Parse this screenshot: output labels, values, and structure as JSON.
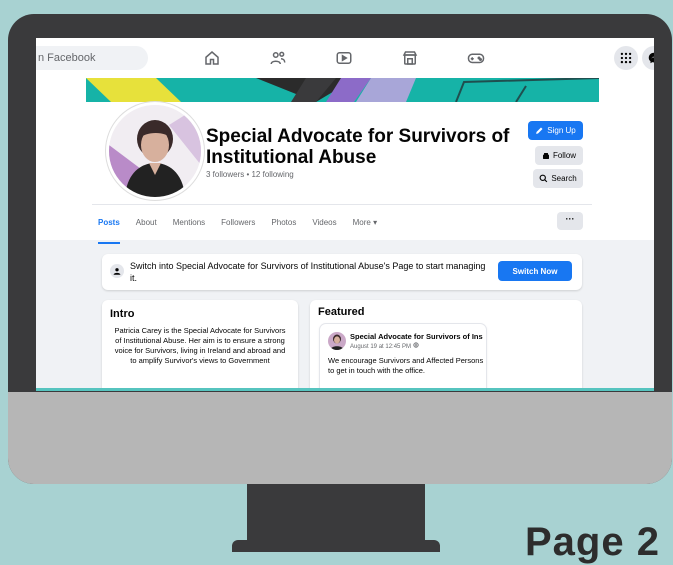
{
  "topbar": {
    "search_placeholder": "n Facebook",
    "nav_icons": [
      "home-icon",
      "friends-icon",
      "watch-icon",
      "marketplace-icon",
      "gaming-icon"
    ],
    "right_icons": [
      "menu-grid-icon",
      "messenger-icon"
    ]
  },
  "profile": {
    "name": "Special Advocate for Survivors of Institutional Abuse",
    "follows": "3 followers • 12 following",
    "buttons": {
      "signup": "Sign Up",
      "follow": "Follow",
      "search": "Search"
    }
  },
  "tabs": [
    "Posts",
    "About",
    "Mentions",
    "Followers",
    "Photos",
    "Videos",
    "More ▾"
  ],
  "more_button": "···",
  "switch_banner": {
    "text": "Switch into Special Advocate for Survivors of Institutional Abuse's Page to start managing it.",
    "button": "Switch Now"
  },
  "intro": {
    "title": "Intro",
    "text": "Patricia Carey is the Special Advocate for Survivors of Institutional Abuse. Her aim is to ensure a strong voice for Survivors, living in Ireland and abroad and to amplify Survivor's views to Government"
  },
  "featured": {
    "title": "Featured",
    "post": {
      "author": "Special Advocate for Survivors of Ins",
      "date": "August 19 at 12:45 PM",
      "text": "We encourage Survivors and Affected Persons to get in touch with the office."
    }
  },
  "page_label": "Page 2",
  "colors": {
    "background": "#a8d2d2",
    "monitor": "#3a3a3c",
    "accent": "#1877f2",
    "cover": "#16b3a7"
  }
}
